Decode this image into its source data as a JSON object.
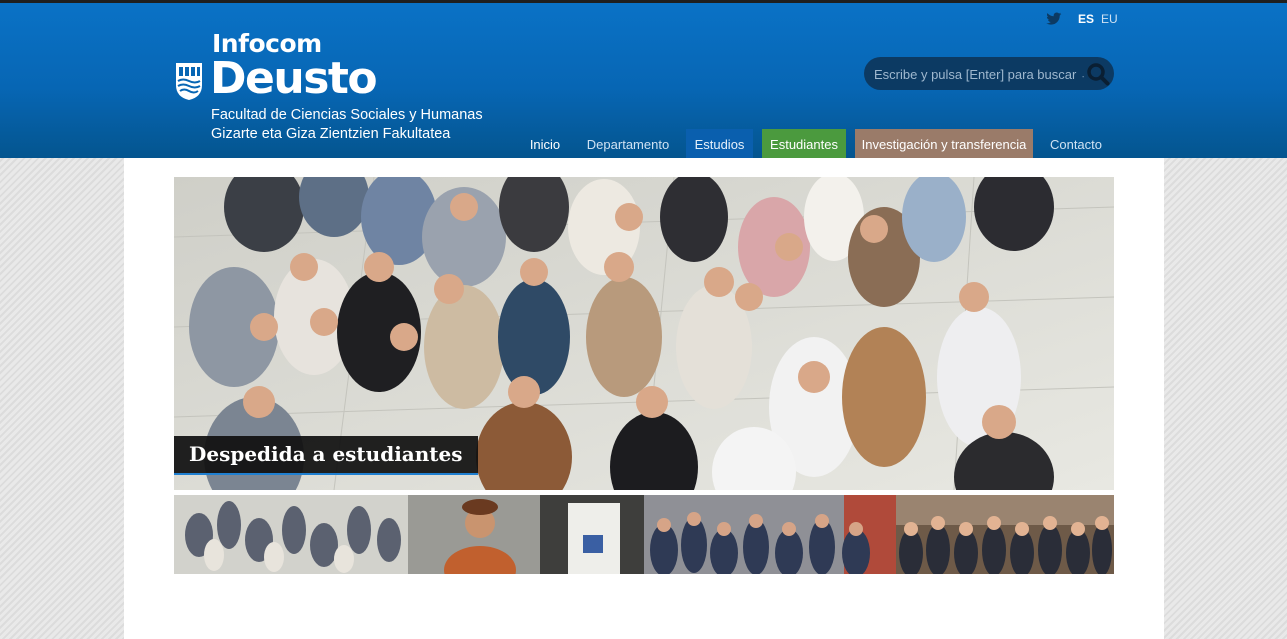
{
  "header": {
    "logo": {
      "infocom": "Infocom",
      "deusto": "Deusto",
      "line1": "Facultad de Ciencias Sociales y Humanas",
      "line2": "Gizarte eta Giza Zientzien Fakultatea"
    },
    "social": {
      "icon": "twitter-icon"
    },
    "languages": [
      {
        "label": "ES",
        "active": true
      },
      {
        "label": "EU",
        "active": false
      }
    ],
    "search": {
      "placeholder": "Escribe y pulsa [Enter] para buscar →",
      "icon": "search-icon"
    },
    "nav": [
      {
        "label": "Inicio"
      },
      {
        "label": "Departamento"
      },
      {
        "label": "Estudios",
        "color": "#0a5fae"
      },
      {
        "label": "Estudiantes",
        "color": "#4b9a3e"
      },
      {
        "label": "Investigación y transferencia",
        "color": "#9a7b69"
      },
      {
        "label": "Contacto"
      }
    ]
  },
  "slider": {
    "caption": "Despedida a estudiantes"
  },
  "colors": {
    "header_blue": "#0766b4",
    "search_bg": "#0c3a63",
    "caption_underline": "#1f7fd0"
  }
}
